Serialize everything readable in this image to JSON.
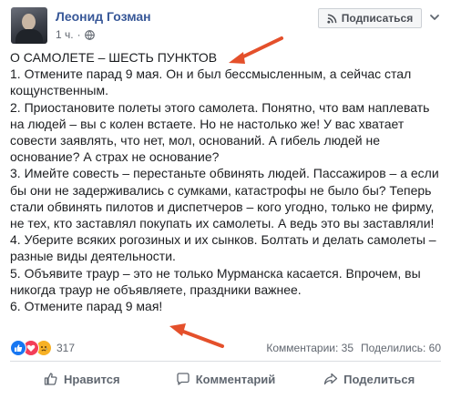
{
  "header": {
    "author_name": "Леонид Гозман",
    "timestamp": "1 ч.",
    "privacy_icon": "globe-icon",
    "subscribe_label": "Подписаться",
    "subscribe_icon": "rss-icon",
    "menu_icon": "chevron-down-icon"
  },
  "post": {
    "lines": [
      "О САМОЛЕТЕ – ШЕСТЬ ПУНКТОВ",
      "1. Отмените парад 9 мая. Он и был бессмысленным, а сейчас стал кощунственным.",
      "2. Приостановите полеты этого самолета. Понятно, что вам наплевать на людей – вы с колен встаете. Но не настолько же! У вас хватает совести заявлять, что нет, мол, оснований. А гибель людей не основание? А страх не основание?",
      "3. Имейте совесть – перестаньте обвинять людей. Пассажиров – а если бы они не задерживались с сумками, катастрофы не было бы? Теперь стали обвинять пилотов и диспетчеров – кого угодно, только не фирму, не тех, кто заставлял покупать их самолеты. А ведь это вы заставляли!",
      "4. Уберите всяких рогозиных и их сынков. Болтать и делать самолеты – разные виды деятельности.",
      "5. Объявите траур – это не только Мурманска касается. Впрочем, вы никогда траур не объявляете, праздники важнее.",
      "6. Отмените парад 9 мая!"
    ]
  },
  "reactions": {
    "icons": [
      "like-icon",
      "love-icon",
      "sad-icon"
    ],
    "count": "317"
  },
  "stats": {
    "comments": "Комментарии: 35",
    "shares": "Поделились: 60"
  },
  "actions": {
    "like_label": "Нравится",
    "comment_label": "Комментарий",
    "share_label": "Поделиться"
  },
  "colors": {
    "author_link": "#385898",
    "annotation_arrow": "#e4502b",
    "like_blue": "#1877f2"
  }
}
